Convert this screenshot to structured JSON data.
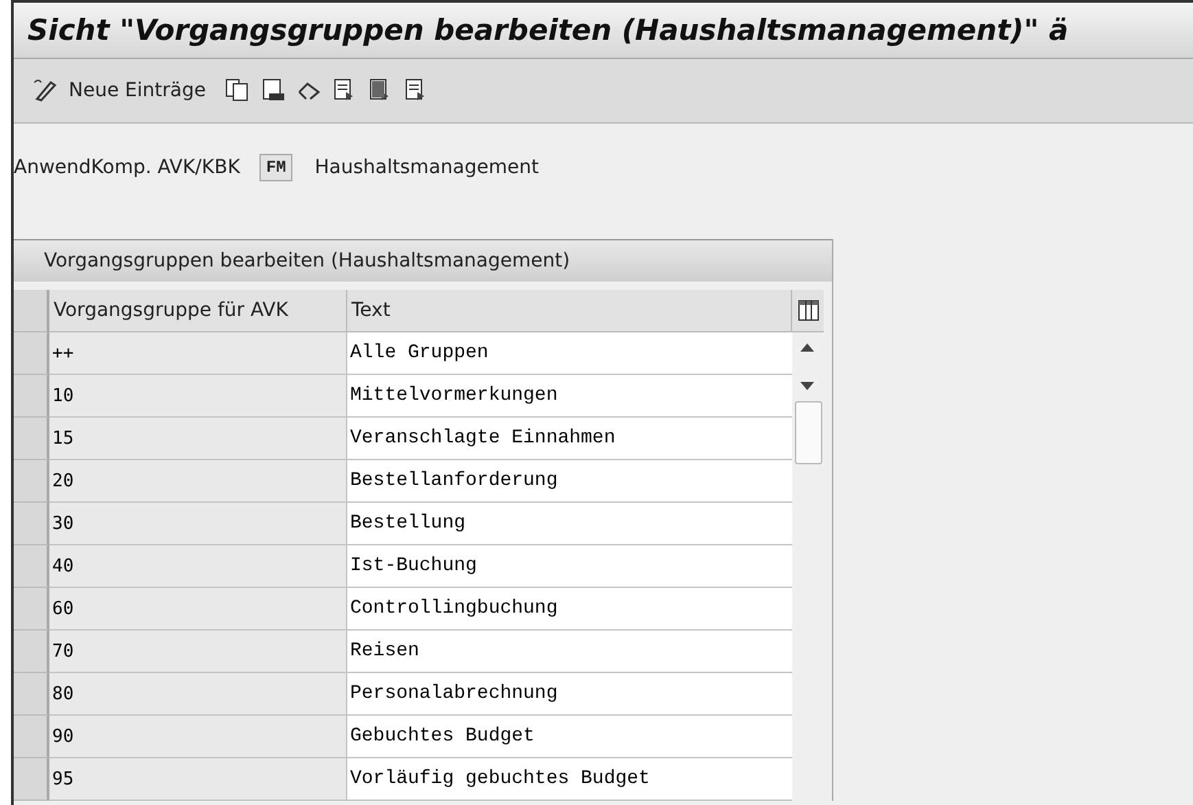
{
  "window": {
    "title": "Sicht \"Vorgangsgruppen bearbeiten (Haushaltsmanagement)\" ä"
  },
  "toolbar": {
    "new_entries": "Neue Einträge"
  },
  "field": {
    "label": "AnwendKomp. AVK/KBK",
    "value": "FM",
    "description": "Haushaltsmanagement"
  },
  "table": {
    "title": "Vorgangsgruppen bearbeiten (Haushaltsmanagement)",
    "columns": [
      "Vorgangsgruppe für AVK",
      "Text"
    ],
    "rows": [
      {
        "group": "++",
        "text": "Alle Gruppen"
      },
      {
        "group": "10",
        "text": "Mittelvormerkungen"
      },
      {
        "group": "15",
        "text": "Veranschlagte Einnahmen"
      },
      {
        "group": "20",
        "text": "Bestellanforderung"
      },
      {
        "group": "30",
        "text": "Bestellung"
      },
      {
        "group": "40",
        "text": "Ist-Buchung"
      },
      {
        "group": "60",
        "text": "Controllingbuchung"
      },
      {
        "group": "70",
        "text": "Reisen"
      },
      {
        "group": "80",
        "text": "Personalabrechnung"
      },
      {
        "group": "90",
        "text": "Gebuchtes Budget"
      },
      {
        "group": "95",
        "text": "Vorläufig gebuchtes Budget"
      }
    ]
  }
}
